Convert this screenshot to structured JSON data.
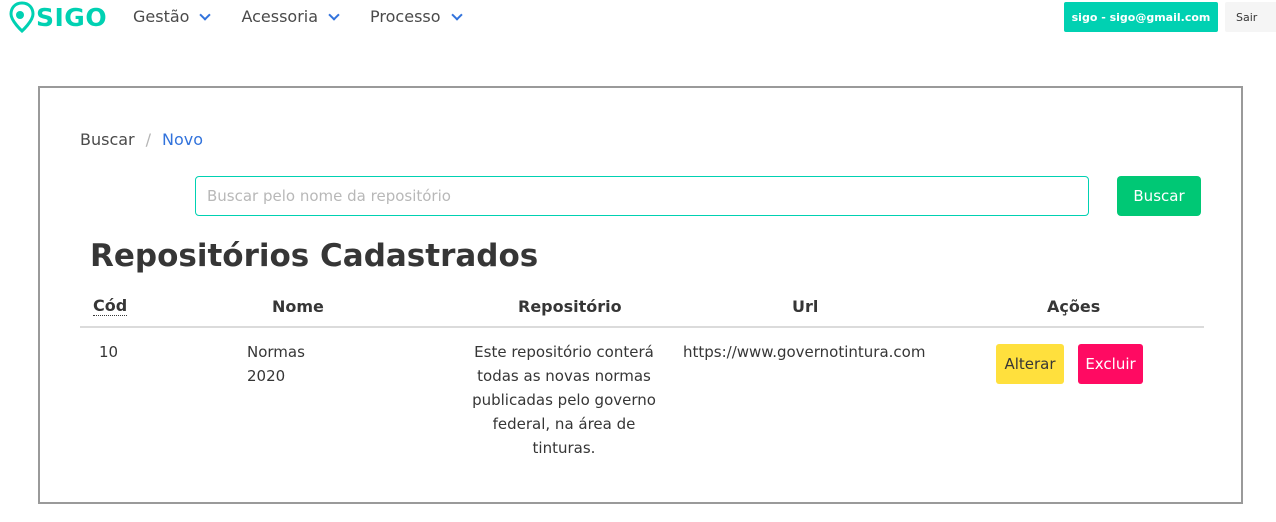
{
  "navbar": {
    "brand": "SIGO",
    "items": [
      {
        "label": "Gestão"
      },
      {
        "label": "Acessoria"
      },
      {
        "label": "Processo"
      }
    ],
    "user_label": "sigo - sigo@gmail.com",
    "logout_label": "Sair"
  },
  "breadcrumb": [
    "Buscar",
    "Novo"
  ],
  "search": {
    "placeholder": "Buscar pelo nome da repositório",
    "value": "",
    "button_label": "Buscar"
  },
  "page_title": "Repositórios Cadastrados",
  "table": {
    "headers": [
      "Cód",
      "Nome",
      "Repositório",
      "Url",
      "Ações"
    ],
    "rows": [
      {
        "cod": "10",
        "nome": "Normas 2020",
        "repositorio": "Este repositório conterá todas as novas normas publicadas pelo governo federal, na área de tinturas.",
        "url": "https://www.governotintura.com",
        "alterar_label": "Alterar",
        "excluir_label": "Excluir"
      }
    ]
  },
  "colors": {
    "primary": "#00d1b2",
    "success": "#00c875",
    "warning": "#ffe03d",
    "danger": "#ff0a62",
    "link": "#3273dc"
  },
  "icons": [
    "map-pin-icon",
    "chevron-down-icon"
  ]
}
